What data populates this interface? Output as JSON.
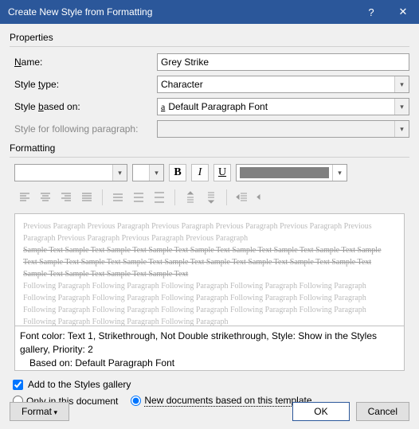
{
  "titlebar": {
    "title": "Create New Style from Formatting"
  },
  "sections": {
    "properties": "Properties",
    "formatting": "Formatting"
  },
  "labels": {
    "name": "Name:",
    "styletype": "Style type:",
    "basedon": "Style based on:",
    "following": "Style for following paragraph:"
  },
  "props": {
    "name": "Grey Strike",
    "styletype": "Character",
    "basedon": "Default Paragraph Font",
    "following": ""
  },
  "fmtbtns": {
    "bold": "B",
    "italic": "I",
    "underline": "U"
  },
  "preview": {
    "prev": "Previous Paragraph Previous Paragraph Previous Paragraph Previous Paragraph Previous Paragraph Previous Paragraph Previous Paragraph Previous Paragraph Previous Paragraph",
    "sample": "Sample Text Sample Text Sample Text Sample Text Sample Text Sample Text Sample Text Sample Text Sample Text Sample Text Sample Text Sample Text Sample Text Sample Text Sample Text Sample Text Sample Text Sample Text Sample Text Sample Text Sample Text",
    "foll": "Following Paragraph Following Paragraph Following Paragraph Following Paragraph Following Paragraph Following Paragraph Following Paragraph Following Paragraph Following Paragraph Following Paragraph Following Paragraph Following Paragraph Following Paragraph Following Paragraph Following Paragraph Following Paragraph Following Paragraph Following Paragraph"
  },
  "desc": {
    "line1": "Font color: Text 1, Strikethrough, Not Double strikethrough, Style: Show in the Styles gallery, Priority: 2",
    "line2": "Based on: Default Paragraph Font"
  },
  "opts": {
    "addgallery": "Add to the Styles gallery",
    "onlydoc": "Only in this document",
    "newdocs": "New documents based on this template"
  },
  "buttons": {
    "format": "Format",
    "ok": "OK",
    "cancel": "Cancel"
  }
}
